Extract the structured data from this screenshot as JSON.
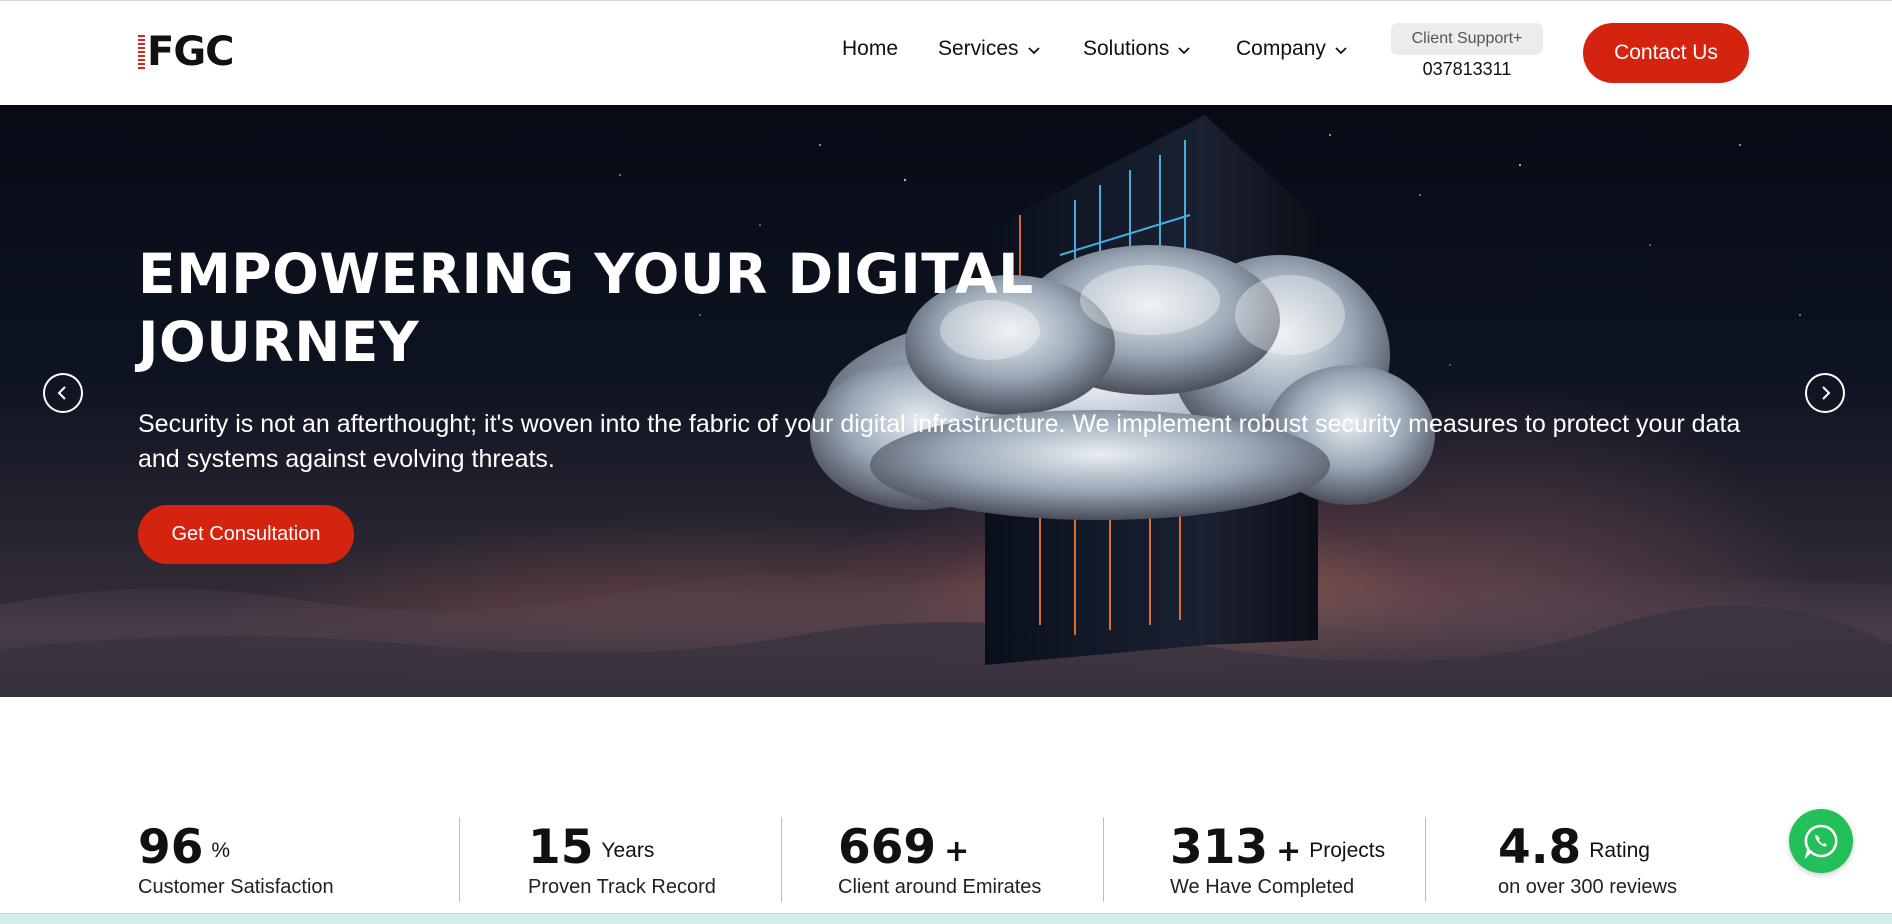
{
  "header": {
    "logo_text": "FGC",
    "nav": [
      {
        "label": "Home",
        "has_dropdown": false
      },
      {
        "label": "Services",
        "has_dropdown": true
      },
      {
        "label": "Solutions",
        "has_dropdown": true
      },
      {
        "label": "Company",
        "has_dropdown": true
      }
    ],
    "support_label": "Client Support+",
    "support_phone": "037813311",
    "contact_label": "Contact Us"
  },
  "hero": {
    "title_line1": "EMPOWERING YOUR DIGITAL",
    "title_line2": "JOURNEY",
    "description": "Security is not an afterthought; it's woven into the fabric of your digital infrastructure. We implement robust security measures to protect your data and systems against evolving threats.",
    "cta_label": "Get Consultation"
  },
  "stats": [
    {
      "value": "96",
      "suffix": "%",
      "plus": "",
      "label": "Customer Satisfaction"
    },
    {
      "value": "15",
      "suffix": "Years",
      "plus": "",
      "label": "Proven Track Record"
    },
    {
      "value": "669",
      "suffix": "",
      "plus": "+",
      "label": "Client around Emirates"
    },
    {
      "value": "313",
      "suffix": "Projects",
      "plus": "+",
      "label": "We Have Completed"
    },
    {
      "value": "4.8",
      "suffix": "Rating",
      "plus": "",
      "label": "on over 300 reviews"
    }
  ],
  "colors": {
    "accent": "#d42410",
    "whatsapp": "#23c05a"
  },
  "icons": {
    "prev": "chevron-left-icon",
    "next": "chevron-right-icon",
    "dropdown": "chevron-down-icon",
    "whatsapp": "whatsapp-icon"
  }
}
